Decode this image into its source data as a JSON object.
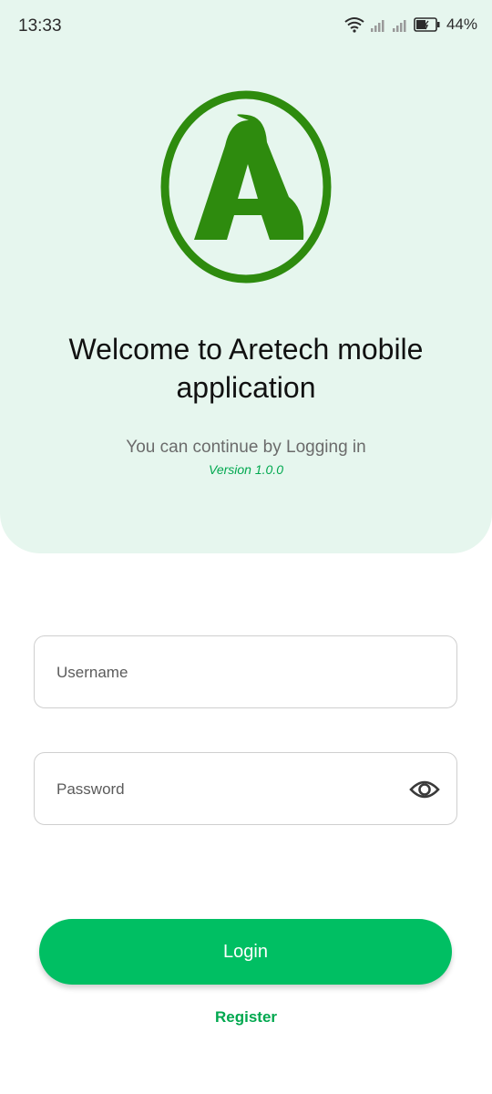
{
  "status_bar": {
    "time": "13:33",
    "battery_percent": "44%",
    "icons": [
      "wifi-icon",
      "cellular-signal-icon",
      "battery-charging-icon"
    ]
  },
  "brand": {
    "logo_icon": "aretech-logo-icon",
    "logo_letter": "A",
    "primary_color": "#2e8b0e",
    "accent_color": "#00bf63"
  },
  "hero": {
    "title": "Welcome to Aretech mobile application",
    "subtitle": "You can continue by Logging in",
    "version": "Version 1.0.0"
  },
  "form": {
    "username": {
      "placeholder": "Username",
      "value": ""
    },
    "password": {
      "placeholder": "Password",
      "value": "",
      "toggle_icon": "eye-icon"
    }
  },
  "actions": {
    "login_label": "Login",
    "register_label": "Register"
  }
}
